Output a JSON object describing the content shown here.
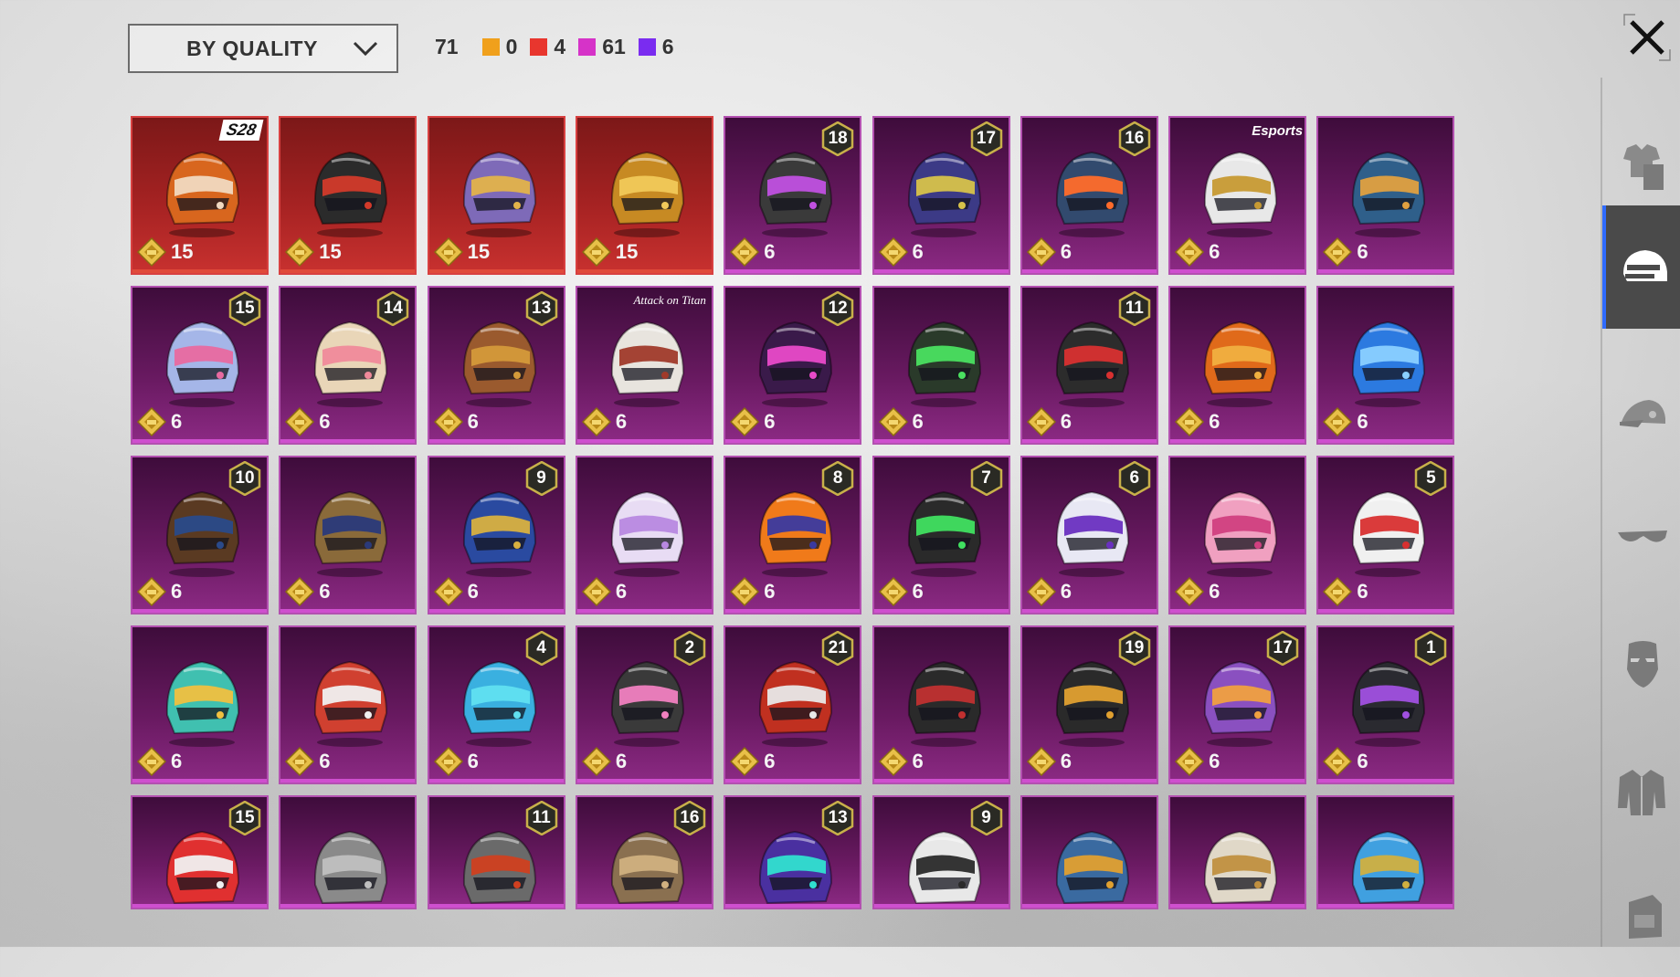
{
  "sort": {
    "label": "BY QUALITY"
  },
  "counts": {
    "total": "71",
    "qualities": [
      {
        "color": "#f0a01c",
        "count": "0"
      },
      {
        "color": "#e8362e",
        "count": "4"
      },
      {
        "color": "#d633c8",
        "count": "61"
      },
      {
        "color": "#7a2cf0",
        "count": "6"
      }
    ]
  },
  "sidebar": {
    "items": [
      {
        "icon": "outfit-icon",
        "active": false
      },
      {
        "icon": "helmet-icon",
        "active": true
      },
      {
        "icon": "cap-icon",
        "active": false
      },
      {
        "icon": "glasses-icon",
        "active": false
      },
      {
        "icon": "mask-icon",
        "active": false
      },
      {
        "icon": "jacket-icon",
        "active": false
      },
      {
        "icon": "backpack-icon",
        "active": false
      }
    ]
  },
  "items": [
    {
      "quality": "red",
      "cost": "15",
      "tag": "S28",
      "c1": "#d8661e",
      "c2": "#f1d9c0"
    },
    {
      "quality": "red",
      "cost": "15",
      "tag": "",
      "c1": "#2b2b2b",
      "c2": "#d23a2a"
    },
    {
      "quality": "red",
      "cost": "15",
      "tag": "",
      "c1": "#7e6ab8",
      "c2": "#e3b34a"
    },
    {
      "quality": "red",
      "cost": "15",
      "tag": "",
      "c1": "#c78a23",
      "c2": "#f1c95a"
    },
    {
      "quality": "purple",
      "cost": "6",
      "badge": "18",
      "c1": "#3a3a3a",
      "c2": "#c050e0"
    },
    {
      "quality": "purple",
      "cost": "6",
      "badge": "17",
      "c1": "#3c3a86",
      "c2": "#d7c24a"
    },
    {
      "quality": "purple",
      "cost": "6",
      "badge": "16",
      "c1": "#324a6e",
      "c2": "#ff6b2a"
    },
    {
      "quality": "purple",
      "cost": "6",
      "tag": "ESPORTS",
      "c1": "#e8e8e8",
      "c2": "#c79a33"
    },
    {
      "quality": "purple",
      "cost": "6",
      "c1": "#2f5f8a",
      "c2": "#e0a040"
    },
    {
      "quality": "purple",
      "cost": "6",
      "badge": "15",
      "c1": "#a5b6e8",
      "c2": "#e86aa0"
    },
    {
      "quality": "purple",
      "cost": "6",
      "badge": "14",
      "c1": "#e9d6b8",
      "c2": "#f08a9a"
    },
    {
      "quality": "purple",
      "cost": "6",
      "badge": "13",
      "c1": "#9a5a2e",
      "c2": "#d49a3a"
    },
    {
      "quality": "purple",
      "cost": "6",
      "tag": "Attack on Titan",
      "c1": "#e8e4de",
      "c2": "#a03a2a"
    },
    {
      "quality": "purple",
      "cost": "6",
      "badge": "12",
      "c1": "#3a1a4a",
      "c2": "#e84ac8"
    },
    {
      "quality": "purple",
      "cost": "6",
      "c1": "#2a3a2a",
      "c2": "#4ae060"
    },
    {
      "quality": "purple",
      "cost": "6",
      "badge": "11",
      "c1": "#2c2c2c",
      "c2": "#d83030"
    },
    {
      "quality": "purple",
      "cost": "6",
      "c1": "#e06a1a",
      "c2": "#f0b040"
    },
    {
      "quality": "purple",
      "cost": "6",
      "c1": "#2c7ae0",
      "c2": "#8ad0ff"
    },
    {
      "quality": "purple",
      "cost": "6",
      "badge": "10",
      "c1": "#5a3a22",
      "c2": "#2a4a8a"
    },
    {
      "quality": "purple",
      "cost": "6",
      "c1": "#8a6a3a",
      "c2": "#2a3a7a"
    },
    {
      "quality": "purple",
      "cost": "6",
      "badge": "9",
      "c1": "#2a4aa0",
      "c2": "#d8b040"
    },
    {
      "quality": "purple",
      "cost": "6",
      "c1": "#e8dcf4",
      "c2": "#b888e0"
    },
    {
      "quality": "purple",
      "cost": "6",
      "badge": "8",
      "c1": "#f07a1a",
      "c2": "#3a3aa0"
    },
    {
      "quality": "purple",
      "cost": "6",
      "badge": "7",
      "c1": "#2a2a2a",
      "c2": "#40e060"
    },
    {
      "quality": "purple",
      "cost": "6",
      "badge": "6",
      "c1": "#e8e8f4",
      "c2": "#6a30c0"
    },
    {
      "quality": "purple",
      "cost": "6",
      "c1": "#f0a0c0",
      "c2": "#d04080"
    },
    {
      "quality": "purple",
      "cost": "6",
      "badge": "5",
      "c1": "#f0f0f0",
      "c2": "#d83030"
    },
    {
      "quality": "purple",
      "cost": "6",
      "c1": "#40c0b0",
      "c2": "#f0c040"
    },
    {
      "quality": "purple",
      "cost": "6",
      "c1": "#d04030",
      "c2": "#f0f0f0"
    },
    {
      "quality": "purple",
      "cost": "6",
      "badge": "4",
      "c1": "#3ab0e0",
      "c2": "#60e0f0"
    },
    {
      "quality": "purple",
      "cost": "6",
      "badge": "2",
      "c1": "#3a3a3a",
      "c2": "#f080c0"
    },
    {
      "quality": "purple",
      "cost": "6",
      "badge": "21",
      "c1": "#c03020",
      "c2": "#e8e8e8"
    },
    {
      "quality": "purple",
      "cost": "6",
      "c1": "#2a2a2a",
      "c2": "#c03030"
    },
    {
      "quality": "purple",
      "cost": "6",
      "badge": "19",
      "c1": "#2a2a2a",
      "c2": "#e0a030"
    },
    {
      "quality": "purple",
      "cost": "6",
      "badge": "17",
      "c1": "#8a50c0",
      "c2": "#f0a040"
    },
    {
      "quality": "purple",
      "cost": "6",
      "badge": "1",
      "c1": "#2a2a30",
      "c2": "#a050e0"
    },
    {
      "quality": "purple",
      "cost": "",
      "badge": "15",
      "c1": "#e03030",
      "c2": "#f0f0f0"
    },
    {
      "quality": "purple",
      "cost": "",
      "c1": "#8a8a8a",
      "c2": "#c0c0c0"
    },
    {
      "quality": "purple",
      "cost": "",
      "badge": "11",
      "c1": "#6a6a6a",
      "c2": "#d04020"
    },
    {
      "quality": "purple",
      "cost": "",
      "badge": "16",
      "c1": "#8a7050",
      "c2": "#d0b080"
    },
    {
      "quality": "purple",
      "cost": "",
      "badge": "13",
      "c1": "#4a30a0",
      "c2": "#30e0d0"
    },
    {
      "quality": "purple",
      "cost": "",
      "badge": "9",
      "c1": "#e8e8e8",
      "c2": "#2a2a2a"
    },
    {
      "quality": "purple",
      "cost": "",
      "c1": "#3a6aa0",
      "c2": "#e0a030"
    },
    {
      "quality": "purple",
      "cost": "",
      "c1": "#e0d8c8",
      "c2": "#c09040"
    },
    {
      "quality": "purple",
      "cost": "",
      "c1": "#40a0e0",
      "c2": "#d0b040"
    }
  ]
}
